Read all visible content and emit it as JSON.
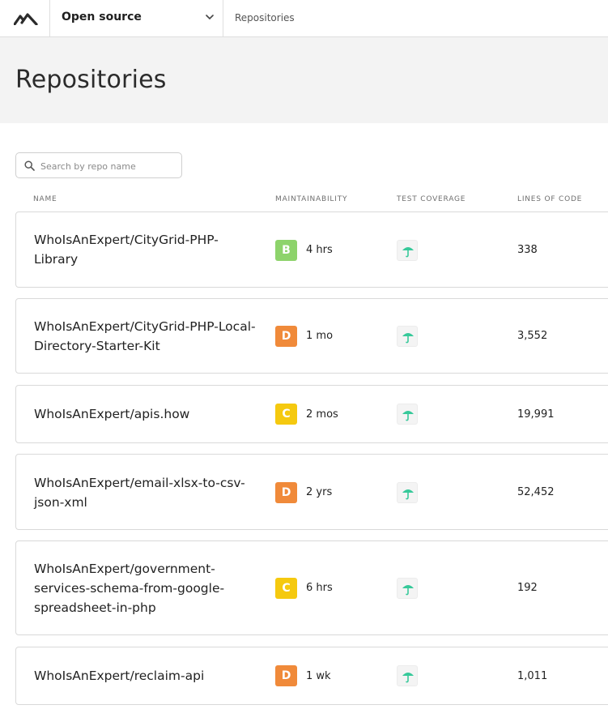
{
  "nav": {
    "logo_icon": "codeclimate-logo-icon",
    "org_name": "Open source",
    "org_chevron_icon": "chevron-down-icon",
    "breadcrumb": "Repositories"
  },
  "page": {
    "title": "Repositories"
  },
  "search": {
    "placeholder": "Search by repo name",
    "icon": "search-icon"
  },
  "columns": {
    "name": "NAME",
    "maintainability": "MAINTAINABILITY",
    "test_coverage": "TEST COVERAGE",
    "lines_of_code": "LINES OF CODE"
  },
  "grade_colors": {
    "B": "#8dd36b",
    "C": "#f5c90f",
    "D": "#f08a3a"
  },
  "coverage_icon": "umbrella-icon",
  "coverage_icon_color": "#37c99a",
  "repos": [
    {
      "name_line1": "WhoIsAnExpert/CityGrid-PHP-",
      "name_line2": "Library",
      "name_line3": "",
      "grade": "B",
      "time": "4 hrs",
      "loc": "338"
    },
    {
      "name_line1": "WhoIsAnExpert/CityGrid-PHP-Local-",
      "name_line2": "Directory-Starter-Kit",
      "name_line3": "",
      "grade": "D",
      "time": "1 mo",
      "loc": "3,552"
    },
    {
      "name_line1": "WhoIsAnExpert/apis.how",
      "name_line2": "",
      "name_line3": "",
      "grade": "C",
      "time": "2 mos",
      "loc": "19,991"
    },
    {
      "name_line1": "WhoIsAnExpert/email-xlsx-to-csv-",
      "name_line2": "json-xml",
      "name_line3": "",
      "grade": "D",
      "time": "2 yrs",
      "loc": "52,452"
    },
    {
      "name_line1": "WhoIsAnExpert/government-",
      "name_line2": "services-schema-from-google-",
      "name_line3": "spreadsheet-in-php",
      "grade": "C",
      "time": "6 hrs",
      "loc": "192"
    },
    {
      "name_line1": "WhoIsAnExpert/reclaim-api",
      "name_line2": "",
      "name_line3": "",
      "grade": "D",
      "time": "1 wk",
      "loc": "1,011"
    }
  ]
}
